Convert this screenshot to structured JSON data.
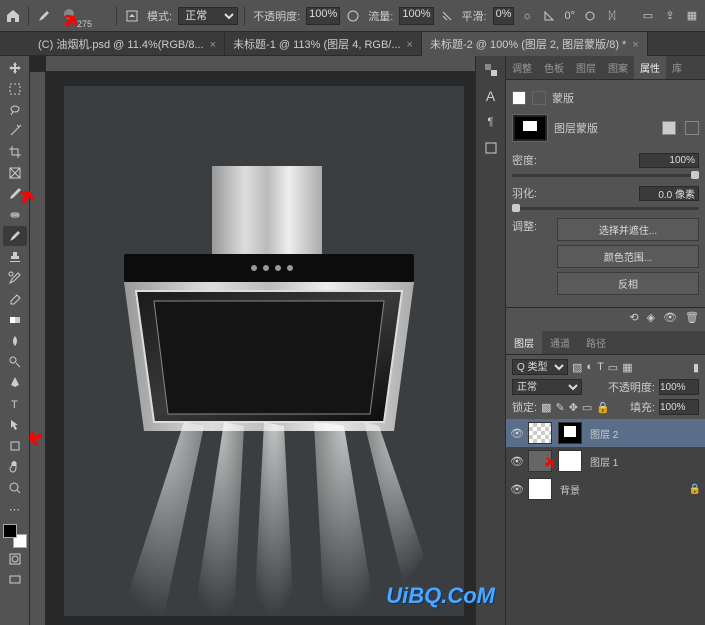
{
  "toolbar": {
    "brush_size": "275",
    "mode_label": "模式:",
    "mode_value": "正常",
    "opacity_label": "不透明度:",
    "opacity_value": "100%",
    "flow_label": "流量:",
    "flow_value": "100%",
    "smoothing_label": "平滑:",
    "smoothing_value": "0%",
    "angle_label": "0°"
  },
  "tabs": [
    {
      "label": "(C) 油烟机.psd @ 11.4%(RGB/8...",
      "active": false
    },
    {
      "label": "未标题-1 @ 113% (图层 4, RGB/...",
      "active": false
    },
    {
      "label": "未标题-2 @ 100% (图层 2, 图层蒙版/8) *",
      "active": true
    }
  ],
  "properties": {
    "tabs": [
      "调整",
      "色板",
      "图层",
      "图案",
      "属性",
      "库"
    ],
    "active_tab": "属性",
    "mask_type_label": "蒙版",
    "mask_sub_label": "图层蒙版",
    "density_label": "密度:",
    "density_value": "100%",
    "feather_label": "羽化:",
    "feather_value": "0.0 像素",
    "refine_label": "调整:",
    "btn_select": "选择并遮住...",
    "btn_color_range": "颜色范围...",
    "btn_invert": "反相"
  },
  "layers_panel": {
    "tabs": [
      "图层",
      "通道",
      "路径"
    ],
    "active_tab": "图层",
    "kind_label": "Q 类型",
    "blend_mode": "正常",
    "opacity_label": "不透明度:",
    "opacity_value": "100%",
    "lock_label": "锁定:",
    "fill_label": "填充:",
    "fill_value": "100%",
    "layers": [
      {
        "name": "图层 2",
        "has_mask": true,
        "selected": true,
        "visible": true
      },
      {
        "name": "图层 1",
        "has_mask": true,
        "selected": false,
        "visible": true
      },
      {
        "name": "背景",
        "has_mask": false,
        "selected": false,
        "visible": true,
        "locked": true
      }
    ]
  },
  "watermark": "UiBQ.CoM"
}
